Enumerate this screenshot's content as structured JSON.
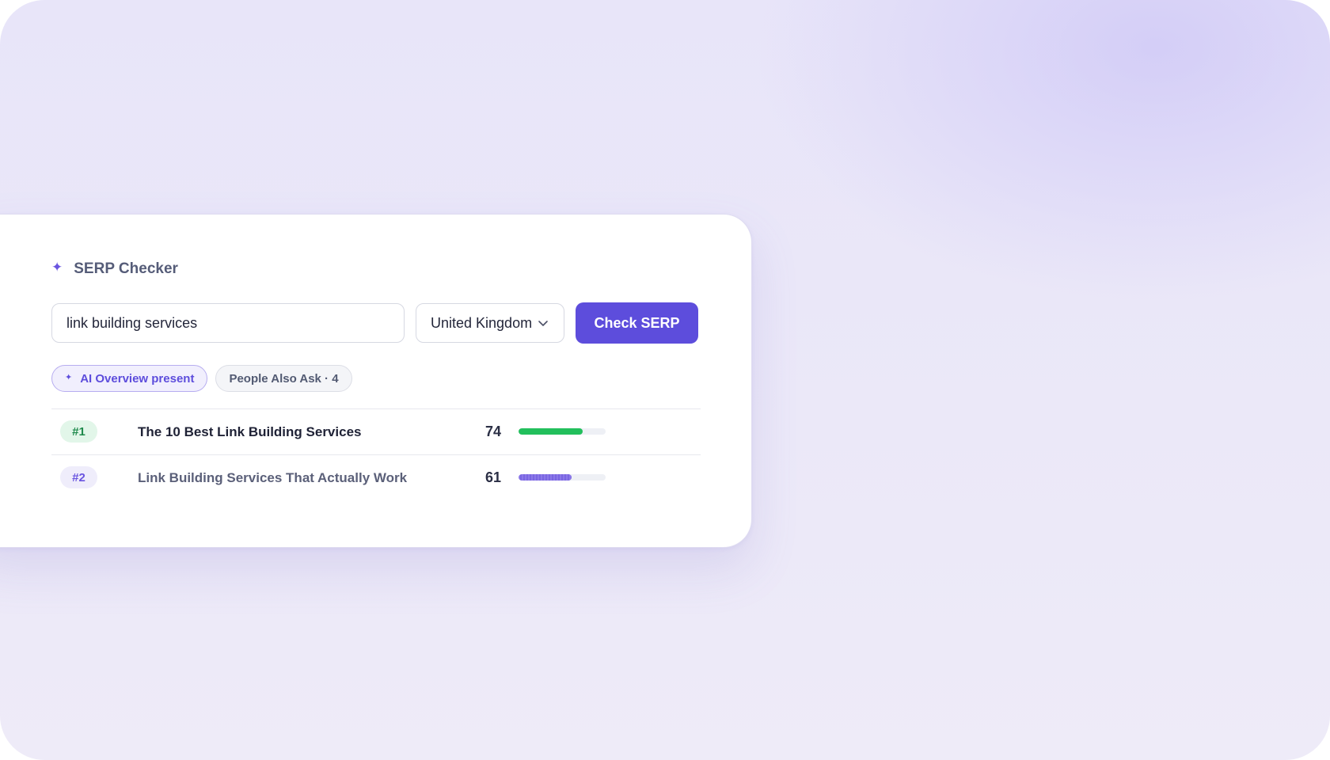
{
  "app": {
    "title": "SERP Checker",
    "accent_color": "#5d4ddc"
  },
  "search": {
    "keyword_value": "link building services",
    "country_value": "United Kingdom",
    "submit_label": "Check SERP"
  },
  "features": [
    {
      "label": "AI Overview present",
      "icon": "sparkle-icon"
    },
    {
      "label": "People Also Ask · 4"
    }
  ],
  "results": [
    {
      "rank": "#1",
      "title": "The 10 Best Link Building Services",
      "score": "74",
      "score_fraction": 0.74,
      "bar_color": "#22bf5c"
    },
    {
      "rank": "#2",
      "title": "Link Building Services That Actually Work",
      "score": "61",
      "score_fraction": 0.61,
      "bar_color": "#8b78e8"
    }
  ]
}
